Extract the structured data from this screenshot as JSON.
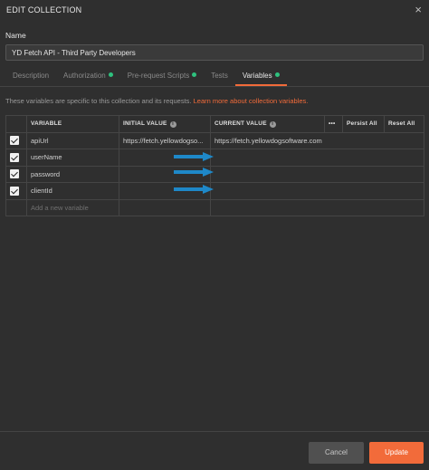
{
  "dialog": {
    "title": "EDIT COLLECTION",
    "close_label": "×"
  },
  "name_section": {
    "label": "Name",
    "value": "YD Fetch API - Third Party Developers"
  },
  "tabs": [
    {
      "label": "Description",
      "dot": false,
      "active": false
    },
    {
      "label": "Authorization",
      "dot": true,
      "active": false
    },
    {
      "label": "Pre-request Scripts",
      "dot": true,
      "active": false
    },
    {
      "label": "Tests",
      "dot": false,
      "active": false
    },
    {
      "label": "Variables",
      "dot": true,
      "active": true
    }
  ],
  "info": {
    "text": "These variables are specific to this collection and its requests. ",
    "link": "Learn more about collection variables."
  },
  "table": {
    "headers": {
      "variable": "VARIABLE",
      "initial_value": "INITIAL VALUE",
      "current_value": "CURRENT VALUE",
      "more": "•••",
      "persist_all": "Persist All",
      "reset_all": "Reset All"
    },
    "rows": [
      {
        "checked": true,
        "variable": "apiUrl",
        "initial_value": "https://fetch.yellowdogso...",
        "current_value": "https://fetch.yellowdogsoftware.com",
        "arrow": false
      },
      {
        "checked": true,
        "variable": "userName",
        "initial_value": "",
        "current_value": "",
        "arrow": true
      },
      {
        "checked": true,
        "variable": "password",
        "initial_value": "",
        "current_value": "",
        "arrow": true
      },
      {
        "checked": true,
        "variable": "clientId",
        "initial_value": "",
        "current_value": "",
        "arrow": true
      }
    ],
    "new_row_placeholder": "Add a new variable"
  },
  "footer": {
    "cancel_label": "Cancel",
    "update_label": "Update"
  },
  "colors": {
    "accent": "#f26b3a",
    "dot": "#2ec27e",
    "arrow": "#1e88c8",
    "background": "#2f2f2f"
  }
}
